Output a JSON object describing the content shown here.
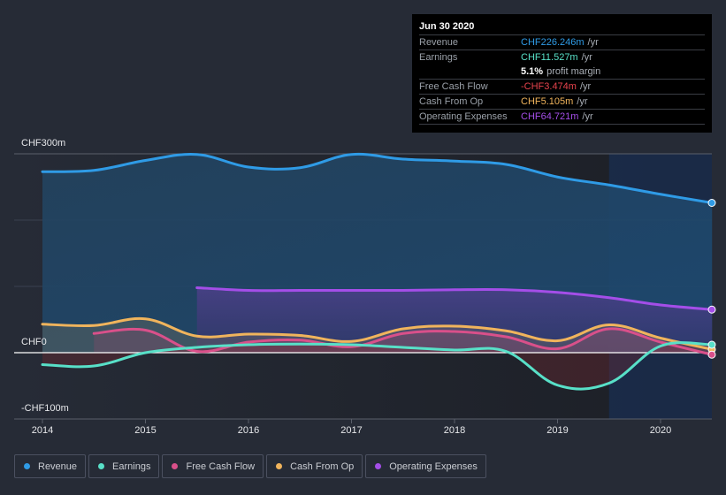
{
  "tooltip": {
    "date": "Jun 30 2020",
    "rows": [
      {
        "label": "Revenue",
        "value": "CHF226.246m",
        "unit": "/yr",
        "color": "#2f9be6"
      },
      {
        "label": "Earnings",
        "value": "CHF11.527m",
        "unit": "/yr",
        "color": "#58e0c8"
      },
      {
        "label": "",
        "value": "5.1%",
        "unit": "profit margin",
        "color": "#ffffff"
      },
      {
        "label": "Free Cash Flow",
        "value": "-CHF3.474m",
        "unit": "/yr",
        "color": "#e8434d"
      },
      {
        "label": "Cash From Op",
        "value": "CHF5.105m",
        "unit": "/yr",
        "color": "#f0b45c"
      },
      {
        "label": "Operating Expenses",
        "value": "CHF64.721m",
        "unit": "/yr",
        "color": "#a44ee8"
      }
    ]
  },
  "legend": [
    {
      "label": "Revenue",
      "color": "#2f9be6"
    },
    {
      "label": "Earnings",
      "color": "#58e0c8"
    },
    {
      "label": "Free Cash Flow",
      "color": "#d9508a"
    },
    {
      "label": "Cash From Op",
      "color": "#f0b45c"
    },
    {
      "label": "Operating Expenses",
      "color": "#a44ee8"
    }
  ],
  "chart_data": {
    "type": "area",
    "title": "",
    "xlabel": "",
    "ylabel": "",
    "xlim": [
      2013.75,
      2020.5
    ],
    "ylim": [
      -100,
      300
    ],
    "yticks": [
      {
        "value": 300,
        "label": "CHF300m"
      },
      {
        "value": 0,
        "label": "CHF0"
      },
      {
        "value": -100,
        "label": "-CHF100m"
      }
    ],
    "xticks": [
      {
        "value": 2014,
        "label": "2014"
      },
      {
        "value": 2015,
        "label": "2015"
      },
      {
        "value": 2016,
        "label": "2016"
      },
      {
        "value": 2017,
        "label": "2017"
      },
      {
        "value": 2018,
        "label": "2018"
      },
      {
        "value": 2019,
        "label": "2019"
      },
      {
        "value": 2020,
        "label": "2020"
      }
    ],
    "grid": true,
    "highlight_region": [
      2019.5,
      2020.5
    ],
    "series": [
      {
        "name": "Revenue",
        "color": "#2f9be6",
        "x": [
          2014.0,
          2014.5,
          2015.0,
          2015.5,
          2016.0,
          2016.5,
          2017.0,
          2017.5,
          2018.0,
          2018.5,
          2019.0,
          2019.5,
          2020.0,
          2020.5
        ],
        "values": [
          273,
          275,
          290,
          299,
          280,
          279,
          299,
          292,
          289,
          284,
          265,
          253,
          239,
          226
        ]
      },
      {
        "name": "Operating Expenses",
        "color": "#a44ee8",
        "x": [
          2015.5,
          2016.0,
          2016.5,
          2017.0,
          2017.5,
          2018.0,
          2018.5,
          2019.0,
          2019.5,
          2020.0,
          2020.5
        ],
        "values": [
          98,
          94,
          94,
          94,
          94,
          95,
          95,
          91,
          83,
          72,
          65
        ]
      },
      {
        "name": "Cash From Op",
        "color": "#f0b45c",
        "x": [
          2014.0,
          2014.5,
          2015.0,
          2015.5,
          2016.0,
          2016.5,
          2017.0,
          2017.5,
          2018.0,
          2018.5,
          2019.0,
          2019.5,
          2020.0,
          2020.5
        ],
        "values": [
          43,
          41,
          51,
          25,
          28,
          26,
          17,
          36,
          40,
          33,
          18,
          42,
          22,
          5
        ]
      },
      {
        "name": "Free Cash Flow",
        "color": "#d9508a",
        "x": [
          2014.5,
          2015.0,
          2015.5,
          2016.0,
          2016.5,
          2017.0,
          2017.5,
          2018.0,
          2018.5,
          2019.0,
          2019.5,
          2020.0,
          2020.5
        ],
        "values": [
          29,
          34,
          2,
          16,
          19,
          9,
          29,
          32,
          24,
          6,
          36,
          16,
          -3
        ]
      },
      {
        "name": "Earnings",
        "color": "#58e0c8",
        "x": [
          2014.0,
          2014.5,
          2015.0,
          2015.5,
          2016.0,
          2016.5,
          2017.0,
          2017.5,
          2018.0,
          2018.5,
          2019.0,
          2019.5,
          2020.0,
          2020.5
        ],
        "values": [
          -18,
          -20,
          0,
          8,
          12,
          13,
          12,
          8,
          4,
          2,
          -49,
          -46,
          10,
          12
        ]
      }
    ]
  }
}
